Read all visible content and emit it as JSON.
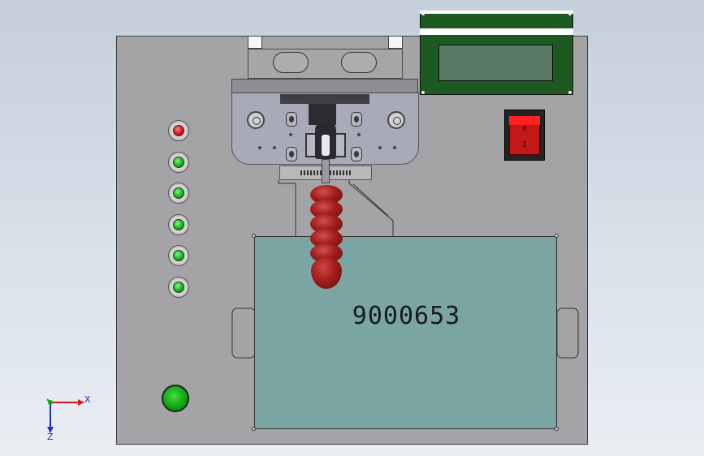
{
  "fixture": {
    "part_number": "9000653"
  },
  "power_switch": {
    "label_off": "0",
    "label_on": "I"
  },
  "status_leds": [
    {
      "color": "red"
    },
    {
      "color": "green"
    },
    {
      "color": "green"
    },
    {
      "color": "green"
    },
    {
      "color": "green"
    },
    {
      "color": "green"
    }
  ],
  "view_triad": {
    "x_label": "X",
    "z_label": "Z"
  },
  "colors": {
    "plate": "#a4a4a6",
    "nest": "#7aa5a3",
    "lcd_board": "#1d5a22",
    "finger": "#a01d1d",
    "start_button": "#0c9c0c"
  }
}
